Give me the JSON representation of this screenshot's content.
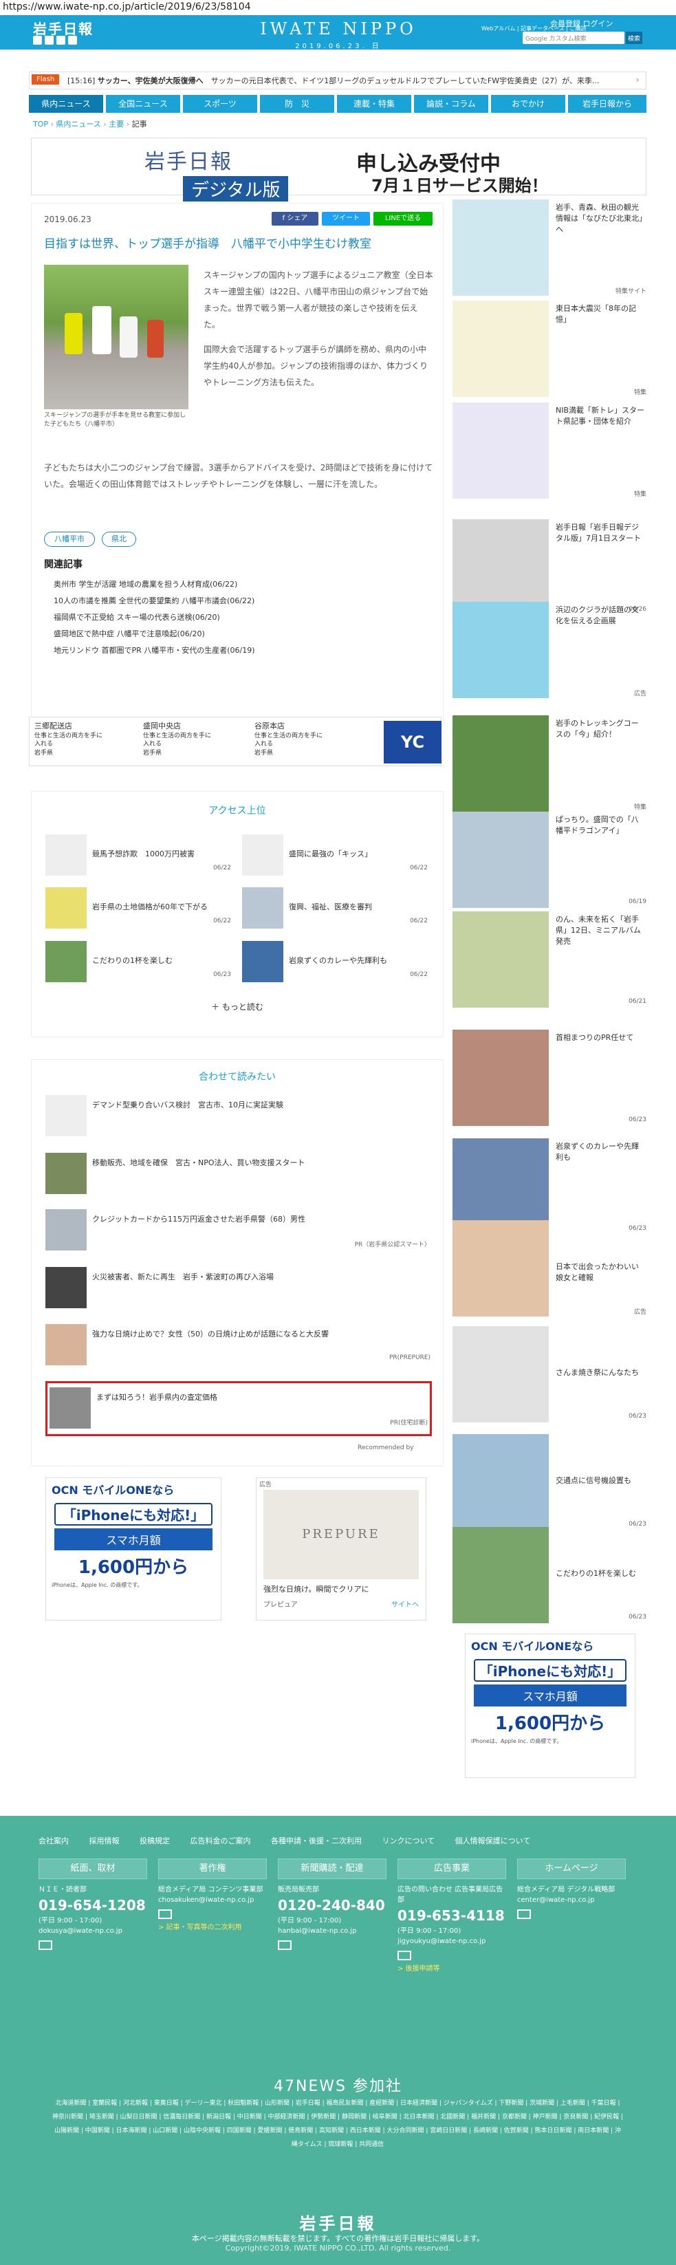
{
  "url": "https://www.iwate-np.co.jp/article/2019/6/23/58104",
  "header": {
    "logo": "岩手日報",
    "brand": "IWATE NIPPO",
    "date": "2019.06.23. 日",
    "login_links": "会員登録  ログイン",
    "sub_links": "Webアルバム  |  記事データベース  |  ご購読",
    "search_placeholder": "Google カスタム検索",
    "search_button": "検索"
  },
  "flash": {
    "label": "Flash",
    "time": "[15:16]",
    "headline": "サッカー、宇佐美が大阪復帰へ",
    "rest": "サッカーの元日本代表で、ドイツ1部リーグのデュッセルドルフでプレーしていたFW宇佐美貴史（27）が、来季..."
  },
  "nav": [
    "県内ニュース",
    "全国ニュース",
    "スポーツ",
    "防　災",
    "連載・特集",
    "論説・コラム",
    "おでかけ",
    "岩手日報から"
  ],
  "breadcrumb": [
    "TOP",
    "県内ニュース",
    "主要",
    "記事"
  ],
  "ad_banner": {
    "logo_text": "岩手日報",
    "digital": "デジタル版",
    "right1": "申し込み受付中",
    "right2": "7月１日サービス開始！"
  },
  "article": {
    "date": "2019.06.23",
    "share_fb": "f シェア",
    "share_tw": "ツイート",
    "share_line": "LINEで送る",
    "title": "目指すは世界、トップ選手が指導　八幡平で小中学生むけ教室",
    "caption": "スキージャンプの選手が手本を見せる教室に参加した子どもたち（八幡平市）",
    "body1": "スキージャンプの国内トップ選手によるジュニア教室（全日本スキー連盟主催）は22日、八幡平市田山の県ジャンプ台で始まった。世界で戦う第一人者が競技の楽しさや技術を伝えた。",
    "body2": "国際大会で活躍するトップ選手らが講師を務め、県内の小中学生約40人が参加。ジャンプの技術指導のほか、体力づくりやトレーニング方法も伝えた。",
    "body3": "子どもたちは大小二つのジャンプ台で練習。3選手からアドバイスを受け、2時間ほどで技術を身に付けていた。会場近くの田山体育館ではストレッチやトレーニングを体験し、一層に汗を流した。",
    "tags": [
      "八幡平市",
      "県北"
    ],
    "related_heading": "関連記事",
    "related": [
      "奥州市 学生が活躍 地域の農業を担う人材育成(06/22)",
      "10人の市議を推薦 全世代の要望集約 八幡平市議会(06/22)",
      "福岡県で不正受給 スキー場の代表ら送検(06/20)",
      "盛岡地区で熱中症 八幡平で注意喚起(06/20)",
      "地元リンドウ  首都圏でPR 八幡平市・安代の生産者(06/19)"
    ]
  },
  "business": [
    {
      "name": "三郷配送店",
      "desc": "仕事と生活の両方を手に入れる",
      "sub": "岩手県"
    },
    {
      "name": "盛岡中央店",
      "desc": "仕事と生活の両方を手に入れる",
      "sub": "岩手県"
    },
    {
      "name": "谷原本店",
      "desc": "仕事と生活の両方を手に入れる",
      "sub": "岩手県"
    },
    {
      "name": "YC",
      "desc": "",
      "sub": ""
    }
  ],
  "ranking": {
    "heading": "アクセス上位",
    "items": [
      {
        "title": "競馬予想詐欺　1000万円被害",
        "date": "06/22"
      },
      {
        "title": "盛岡に最強の「キッス」",
        "date": "06/22"
      },
      {
        "title": "岩手県の土地価格が60年で下がる",
        "date": "06/22"
      },
      {
        "title": "復興、福祉、医療を審判",
        "date": "06/22"
      },
      {
        "title": "こだわりの1杯を楽しむ",
        "date": "06/23"
      },
      {
        "title": "岩泉ずくのカレーや先輝利も",
        "date": "06/22"
      }
    ],
    "more": "もっと読む"
  },
  "recommended": {
    "heading": "合わせて読みたい",
    "items": [
      {
        "title": "デマンド型乗り合いバス検討　宮古市、10月に実証実験",
        "src": ""
      },
      {
        "title": "移動販売、地域を確保　宮古・NPO法人、買い物支援スタート",
        "src": ""
      },
      {
        "title": "クレジットカードから115万円返金させた岩手県警（68）男性",
        "src": "PR（岩手県公認スマート）"
      },
      {
        "title": "火災被害者、新たに再生　岩手・紫波町の再び入浴場",
        "src": ""
      },
      {
        "title": "強力な日焼け止めで？女性（50）の日焼け止めが話題になると大反響",
        "src": "PR(PREPURE)"
      },
      {
        "title": "まずは知ろう！岩手県内の査定価格",
        "src": "PR(住宅診断)"
      }
    ],
    "footer": "Recommended by"
  },
  "ad_ocn": {
    "t1": "OCN モバイルONEなら",
    "t2": "「iPhoneにも対応!」",
    "t3": "スマホ月額",
    "t4": "1,600円から",
    "t5": "iPhoneは、Apple Inc. の商標です。"
  },
  "ad_prepure": {
    "label": "広告",
    "brand": "PREPURE",
    "caption": "強烈な日焼け。瞬間でクリアに",
    "footer_left": "プレピュア",
    "footer_right": "サイトへ"
  },
  "sidebar": [
    {
      "title": "岩手、青森、秋田の観光情報は「なびたび北東北」へ",
      "date": "特集サイト"
    },
    {
      "title": "東日本大震災「8年の記憶」",
      "date": "特集"
    },
    {
      "title": "NIB満載「新トレ」スタート県記事・団体を紹介",
      "date": "特集"
    },
    {
      "title": "岩手日報「岩手日報デジタル版」7月1日スタート",
      "date": "06/26"
    },
    {
      "title": "浜辺のクジラが話題の文化を伝える企画展",
      "date": "広告"
    },
    {
      "title": "岩手のトレッキングコースの「今」紹介！",
      "date": "特集"
    },
    {
      "title": "ぱっちり。盛岡での「八幡平ドラゴンアイ」",
      "date": "06/19"
    },
    {
      "title": "のん、未来を拓く「岩手県」12日、ミニアルバム発売",
      "date": "06/21"
    },
    {
      "title": "首相まつりのPR任せて",
      "date": "06/23"
    },
    {
      "title": "岩泉ずくのカレーや先輝利も",
      "date": "06/23"
    },
    {
      "title": "日本で出会ったかわいい娘女と確報",
      "date": "広告"
    },
    {
      "title": "さんま焼き祭にんなたち",
      "date": "06/23"
    },
    {
      "title": "交通点に信号機設置も",
      "date": "06/23"
    },
    {
      "title": "こだわりの1杯を楽しむ",
      "date": "06/23"
    }
  ],
  "footer": {
    "links": [
      "会社案内",
      "採用情報",
      "投稿規定",
      "広告料金のご案内",
      "各種申請・後援・二次利用",
      "リンクについて",
      "個人情報保護について"
    ],
    "cols": [
      {
        "head": "紙面、取材",
        "dept": "ＮＩＥ・読者部",
        "tel": "019-654-1208",
        "hours": "(平日 9:00 - 17:00)",
        "mail": "dokusya@iwate-np.co.jp",
        "extra": ""
      },
      {
        "head": "著作権",
        "dept": "総合メディア局 コンテンツ事業部",
        "tel": "",
        "hours": "",
        "mail": "chosakuken@iwate-np.co.jp",
        "extra": "> 記事・写真等の二次利用"
      },
      {
        "head": "新聞購読・配達",
        "dept": "販売局販売部",
        "tel": "0120-240-840",
        "hours": "(平日 9:00 - 17:00)",
        "mail": "hanbai@iwate-np.co.jp",
        "extra": ""
      },
      {
        "head": "広告事業",
        "dept": "広告の問い合わせ 広告事業局広告部",
        "tel": "019-653-4118",
        "hours": "(平日 9:00 - 17:00)",
        "mail": "jigyoukyu@iwate-np.co.jp",
        "extra": "> 後援申請等"
      },
      {
        "head": "ホームページ",
        "dept": "総合メディア局 デジタル戦略部",
        "tel": "",
        "hours": "",
        "mail": "center@iwate-np.co.jp",
        "extra": ""
      }
    ],
    "title47": "47NEWS 参加社",
    "list47": "北海道新聞 | 室蘭民報 | 河北新報 | 東奥日報 | デーリー東北 | 秋田魁新報 | 山形新聞 | 岩手日報 | 福島民友新聞 | 産經新聞 | 日本経済新聞 | ジャパンタイムズ | 下野新聞 | 茨城新聞 | 上毛新聞 | 千葉日報 | 神奈川新聞 | 埼玉新聞 | 山梨日日新聞 | 信濃毎日新聞 | 新潟日報 | 中日新聞 | 中部経済新聞 | 伊勢新聞 | 静岡新聞 | 岐阜新聞 | 北日本新聞 | 北國新聞 | 福井新聞 | 京都新聞 | 神戸新聞 | 奈良新聞 | 紀伊民報 | 山陽新聞 | 中国新聞 | 日本海新聞 | 山口新聞 | 山陰中央新報 | 四国新聞 | 愛媛新聞 | 徳島新聞 | 高知新聞 | 西日本新聞 | 大分合同新聞 | 宮崎日日新聞 | 長崎新聞 | 佐賀新聞 | 熊本日日新聞 | 南日本新聞 | 沖縄タイムス | 琉球新報 | 共同通信",
    "logo": "岩手日報",
    "note": "本ページ掲載内容の無断転載を禁じます。すべての著作権は岩手日報社に帰属します。",
    "copyright": "Copyright©2019, IWATE NIPPO CO.,LTD. All rights reserved."
  }
}
